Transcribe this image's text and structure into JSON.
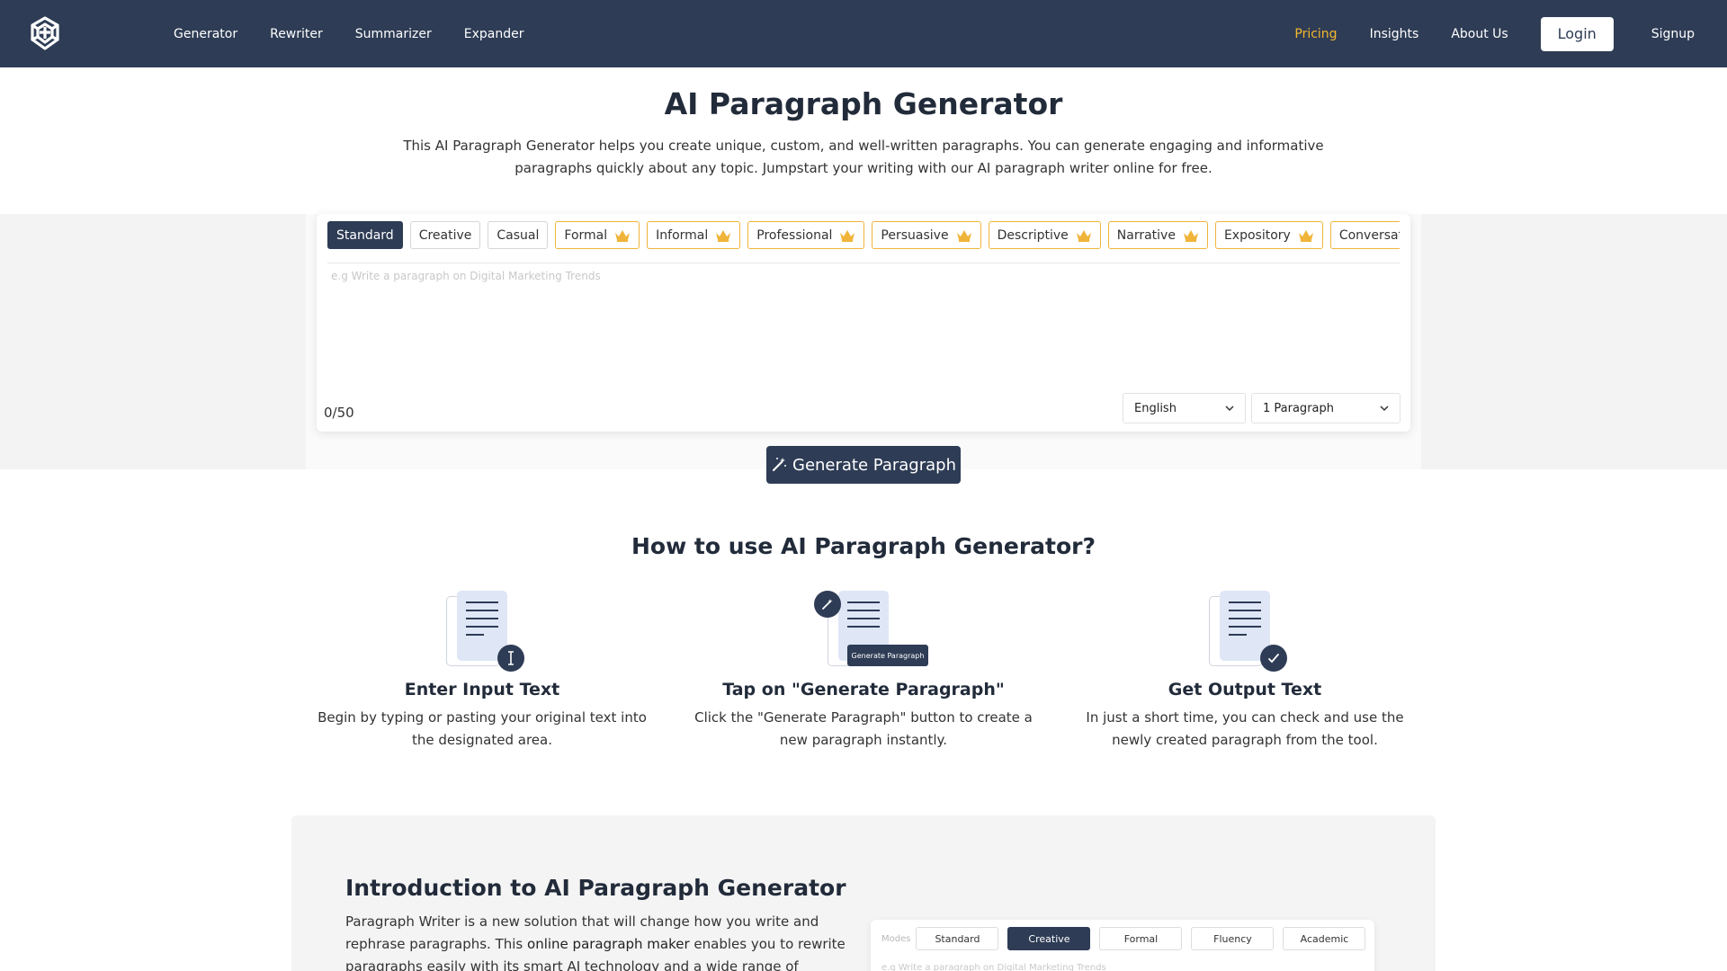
{
  "nav": {
    "links": [
      "Generator",
      "Rewriter",
      "Summarizer",
      "Expander"
    ],
    "pricing": "Pricing",
    "insights": "Insights",
    "about": "About Us",
    "login": "Login",
    "signup": "Signup",
    "accent_color": "#f5b82e",
    "bg_color": "#2e3c55"
  },
  "hero": {
    "title": "AI Paragraph Generator",
    "description": "This AI Paragraph Generator helps you create unique, custom, and well-written paragraphs. You can generate engaging and informative paragraphs quickly about any topic. Jumpstart your writing with our AI paragraph writer online for free."
  },
  "tool": {
    "modes": [
      {
        "label": "Standard",
        "active": true,
        "premium": false
      },
      {
        "label": "Creative",
        "active": false,
        "premium": false
      },
      {
        "label": "Casual",
        "active": false,
        "premium": false
      },
      {
        "label": "Formal",
        "active": false,
        "premium": true
      },
      {
        "label": "Informal",
        "active": false,
        "premium": true
      },
      {
        "label": "Professional",
        "active": false,
        "premium": true
      },
      {
        "label": "Persuasive",
        "active": false,
        "premium": true
      },
      {
        "label": "Descriptive",
        "active": false,
        "premium": true
      },
      {
        "label": "Narrative",
        "active": false,
        "premium": true
      },
      {
        "label": "Expository",
        "active": false,
        "premium": true
      },
      {
        "label": "Conversational",
        "active": false,
        "premium": true
      }
    ],
    "placeholder": "e.g Write a paragraph on Digital Marketing Trends",
    "counter": "0/50",
    "language": "English",
    "paragraph_count": "1 Paragraph",
    "generate_label": "Generate Paragraph"
  },
  "howto": {
    "title": "How to use AI Paragraph Generator?",
    "mini_button": "Generate Paragraph",
    "steps": [
      {
        "title": "Enter Input Text",
        "desc": "Begin by typing or pasting your original text into the designated area."
      },
      {
        "title": "Tap on \"Generate Paragraph\"",
        "desc": "Click the \"Generate Paragraph\" button to create a new paragraph instantly."
      },
      {
        "title": "Get Output Text",
        "desc": "In just a short time, you can check and use the newly created paragraph from the tool."
      }
    ]
  },
  "intro": {
    "title": "Introduction to AI Paragraph Generator",
    "text_before": "Paragraph Writer is a new solution that will change how you write and rephrase paragraphs. This ",
    "link": "online paragraph maker",
    "text_after": " enables you to rewrite paragraphs easily with its smart AI technology and a wide range of capabilities.",
    "preview": {
      "label": "Modes",
      "modes": [
        "Standard",
        "Creative",
        "Formal",
        "Fluency",
        "Academic"
      ],
      "active_index": 1,
      "placeholder": "e.g Write a paragraph on Digital Marketing Trends"
    }
  }
}
